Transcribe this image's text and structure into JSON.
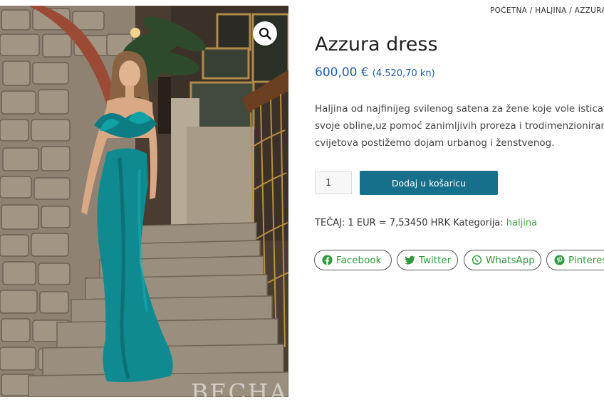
{
  "breadcrumb": {
    "home": "POČETNA",
    "sep1": "/",
    "category": "HALJINA",
    "sep2": "/",
    "current": "AZZURA"
  },
  "gallery": {
    "watermark": "BECHA",
    "zoom_icon": "magnifier-icon"
  },
  "product": {
    "title": "Azzura dress",
    "price": "600,00 €",
    "price_alt": "(4.520,70 kn)",
    "description_lines": [
      "Haljina od najfinijeg svilenog satena za žene koje vole isticati",
      "svoje obline,uz pomoć zanimljivih proreza i trodimenzioniranih",
      "cvijetova postižemo dojam urbanog i ženstvenog."
    ]
  },
  "cart": {
    "quantity": "1",
    "add_label": "Dodaj u košaricu"
  },
  "meta": {
    "rate_text": "TEČAJ: 1 EUR = 7,53450 HRK",
    "category_label": "Kategorija:",
    "category_value": "haljina"
  },
  "share": {
    "facebook": "Facebook",
    "twitter": "Twitter",
    "whatsapp": "WhatsApp",
    "pinterest": "Pinterest"
  },
  "colors": {
    "accent": "#16708c",
    "price": "#1f5ea8",
    "share_green": "#2f9a3c",
    "link_green": "#3aa43a"
  }
}
